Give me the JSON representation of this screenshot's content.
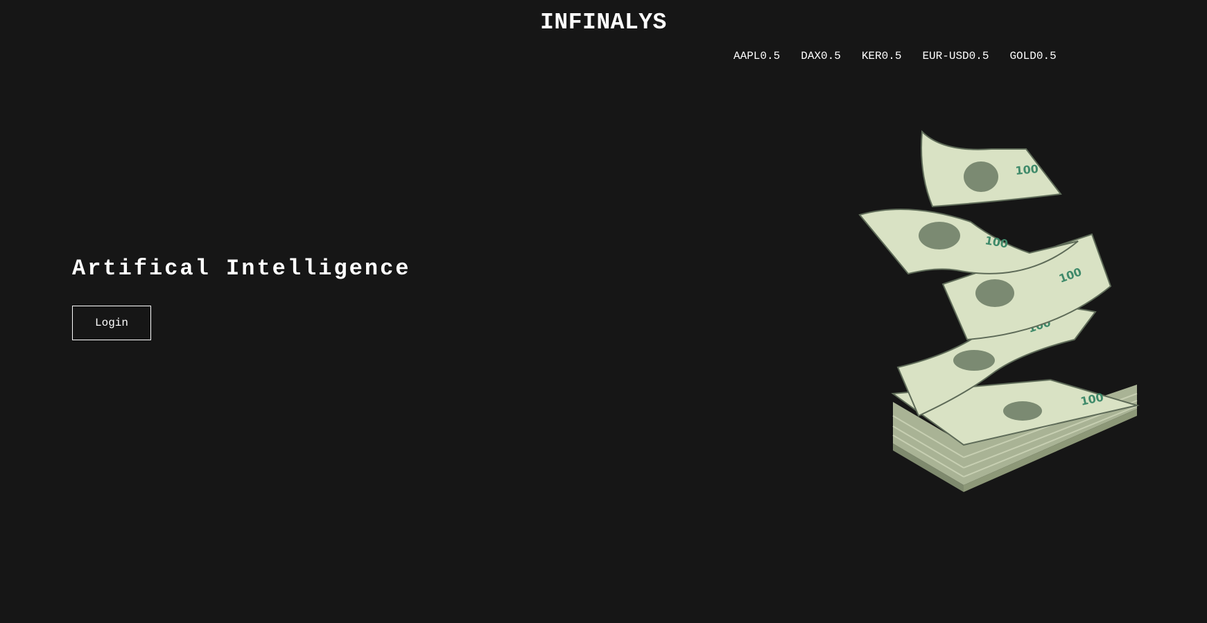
{
  "header": {
    "brand": "INFINALYS"
  },
  "ticker": {
    "items": [
      "AAPL0.5",
      "DAX0.5",
      "KER0.5",
      "EUR-USD0.5",
      "GOLD0.5"
    ]
  },
  "hero": {
    "title": "Artifical Intelligence",
    "login_label": "Login"
  },
  "illustration": {
    "icon": "money-stack-illustration",
    "bill_text": "100"
  },
  "colors": {
    "background": "#161616",
    "text": "#ffffff",
    "bill_light": "#d9e2c4",
    "bill_dark": "#5e6b58",
    "bill_green": "#3f8a6a"
  }
}
